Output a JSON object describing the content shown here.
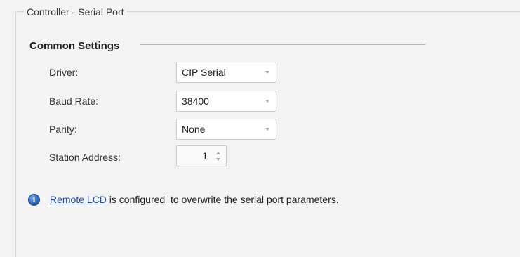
{
  "panel": {
    "title": "Controller - Serial Port"
  },
  "common_settings": {
    "heading": "Common Settings",
    "fields": {
      "driver": {
        "label": "Driver:",
        "value": "CIP Serial"
      },
      "baud_rate": {
        "label": "Baud Rate:",
        "value": "38400"
      },
      "parity": {
        "label": "Parity:",
        "value": "None"
      },
      "station_address": {
        "label": "Station Address:",
        "value": "1"
      }
    }
  },
  "info": {
    "icon": "info-icon",
    "link_text": "Remote LCD",
    "message": " is configured  to overwrite the serial port parameters."
  },
  "colors": {
    "background": "#f3f3f3",
    "link": "#1a4fb0",
    "info_icon": "#2f6cc0"
  }
}
